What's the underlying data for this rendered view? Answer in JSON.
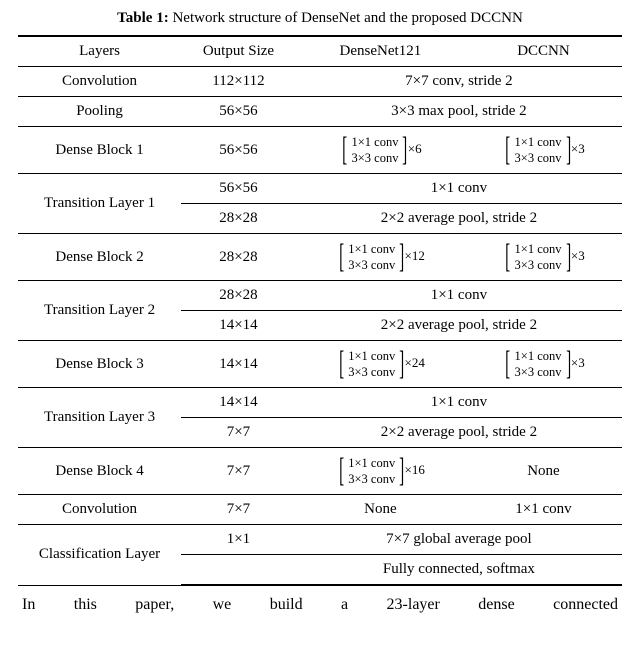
{
  "caption_label": "Table 1:",
  "caption_text": " Network structure of DenseNet and the proposed DCCNN",
  "headers": {
    "layers": "Layers",
    "output_size": "Output Size",
    "densenet": "DenseNet121",
    "dccnn": "DCCNN"
  },
  "rows": {
    "conv": {
      "layer": "Convolution",
      "size": "112×112",
      "detail": "7×7 conv, stride 2"
    },
    "pool": {
      "layer": "Pooling",
      "size": "56×56",
      "detail": "3×3 max pool, stride 2"
    },
    "db1": {
      "layer": "Dense Block 1",
      "size": "56×56",
      "conv_a": "1×1 conv",
      "conv_b": "3×3 conv",
      "densenet_mult": "×6",
      "dccnn_mult": "×3"
    },
    "tl1": {
      "layer": "Transition Layer 1",
      "size_a": "56×56",
      "detail_a": "1×1 conv",
      "size_b": "28×28",
      "detail_b": "2×2 average pool, stride 2"
    },
    "db2": {
      "layer": "Dense Block 2",
      "size": "28×28",
      "conv_a": "1×1 conv",
      "conv_b": "3×3 conv",
      "densenet_mult": "×12",
      "dccnn_mult": "×3"
    },
    "tl2": {
      "layer": "Transition Layer 2",
      "size_a": "28×28",
      "detail_a": "1×1 conv",
      "size_b": "14×14",
      "detail_b": "2×2 average pool, stride 2"
    },
    "db3": {
      "layer": "Dense Block 3",
      "size": "14×14",
      "conv_a": "1×1 conv",
      "conv_b": "3×3 conv",
      "densenet_mult": "×24",
      "dccnn_mult": "×3"
    },
    "tl3": {
      "layer": "Transition Layer 3",
      "size_a": "14×14",
      "detail_a": "1×1 conv",
      "size_b": "7×7",
      "detail_b": "2×2 average pool, stride 2"
    },
    "db4": {
      "layer": "Dense Block 4",
      "size": "7×7",
      "conv_a": "1×1 conv",
      "conv_b": "3×3 conv",
      "densenet_mult": "×16",
      "dccnn": "None"
    },
    "conv2": {
      "layer": "Convolution",
      "size": "7×7",
      "densenet": "None",
      "dccnn": "1×1 conv"
    },
    "cls": {
      "layer": "Classification Layer",
      "size": "1×1",
      "detail_a": "7×7 global average pool",
      "detail_b": "Fully connected, softmax"
    }
  },
  "trailing_text": "In this paper, we build a 23-layer dense connected"
}
